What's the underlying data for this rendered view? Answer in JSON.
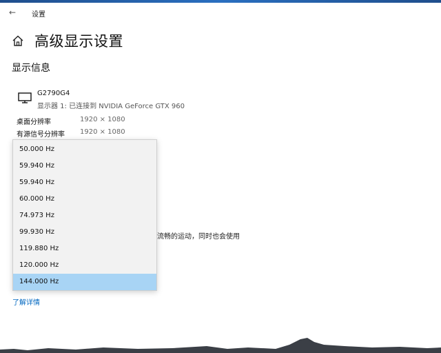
{
  "titlebar": {
    "title": "设置",
    "back_icon": "arrow-left-icon"
  },
  "header": {
    "title": "高级显示设置",
    "home_icon": "home-icon"
  },
  "section": {
    "title": "显示信息"
  },
  "monitor": {
    "name": "G2790G4",
    "description": "显示器 1: 已连接到 NVIDIA GeForce GTX 960",
    "icon": "monitor-icon"
  },
  "info": [
    {
      "label": "桌面分辨率",
      "value": "1920 × 1080"
    },
    {
      "label": "有源信号分辨率",
      "value": "1920 × 1080"
    }
  ],
  "refresh_dropdown": {
    "options": [
      "50.000 Hz",
      "59.940 Hz",
      "59.940 Hz",
      "60.000 Hz",
      "74.973 Hz",
      "99.930 Hz",
      "119.880 Hz",
      "120.000 Hz",
      "144.000 Hz"
    ],
    "selected": "144.000 Hz"
  },
  "partial_text": "流畅的运动，同时也会使用",
  "learn_more": "了解详情",
  "colors": {
    "accent": "#0067c0",
    "selection": "#a8d4f5"
  }
}
